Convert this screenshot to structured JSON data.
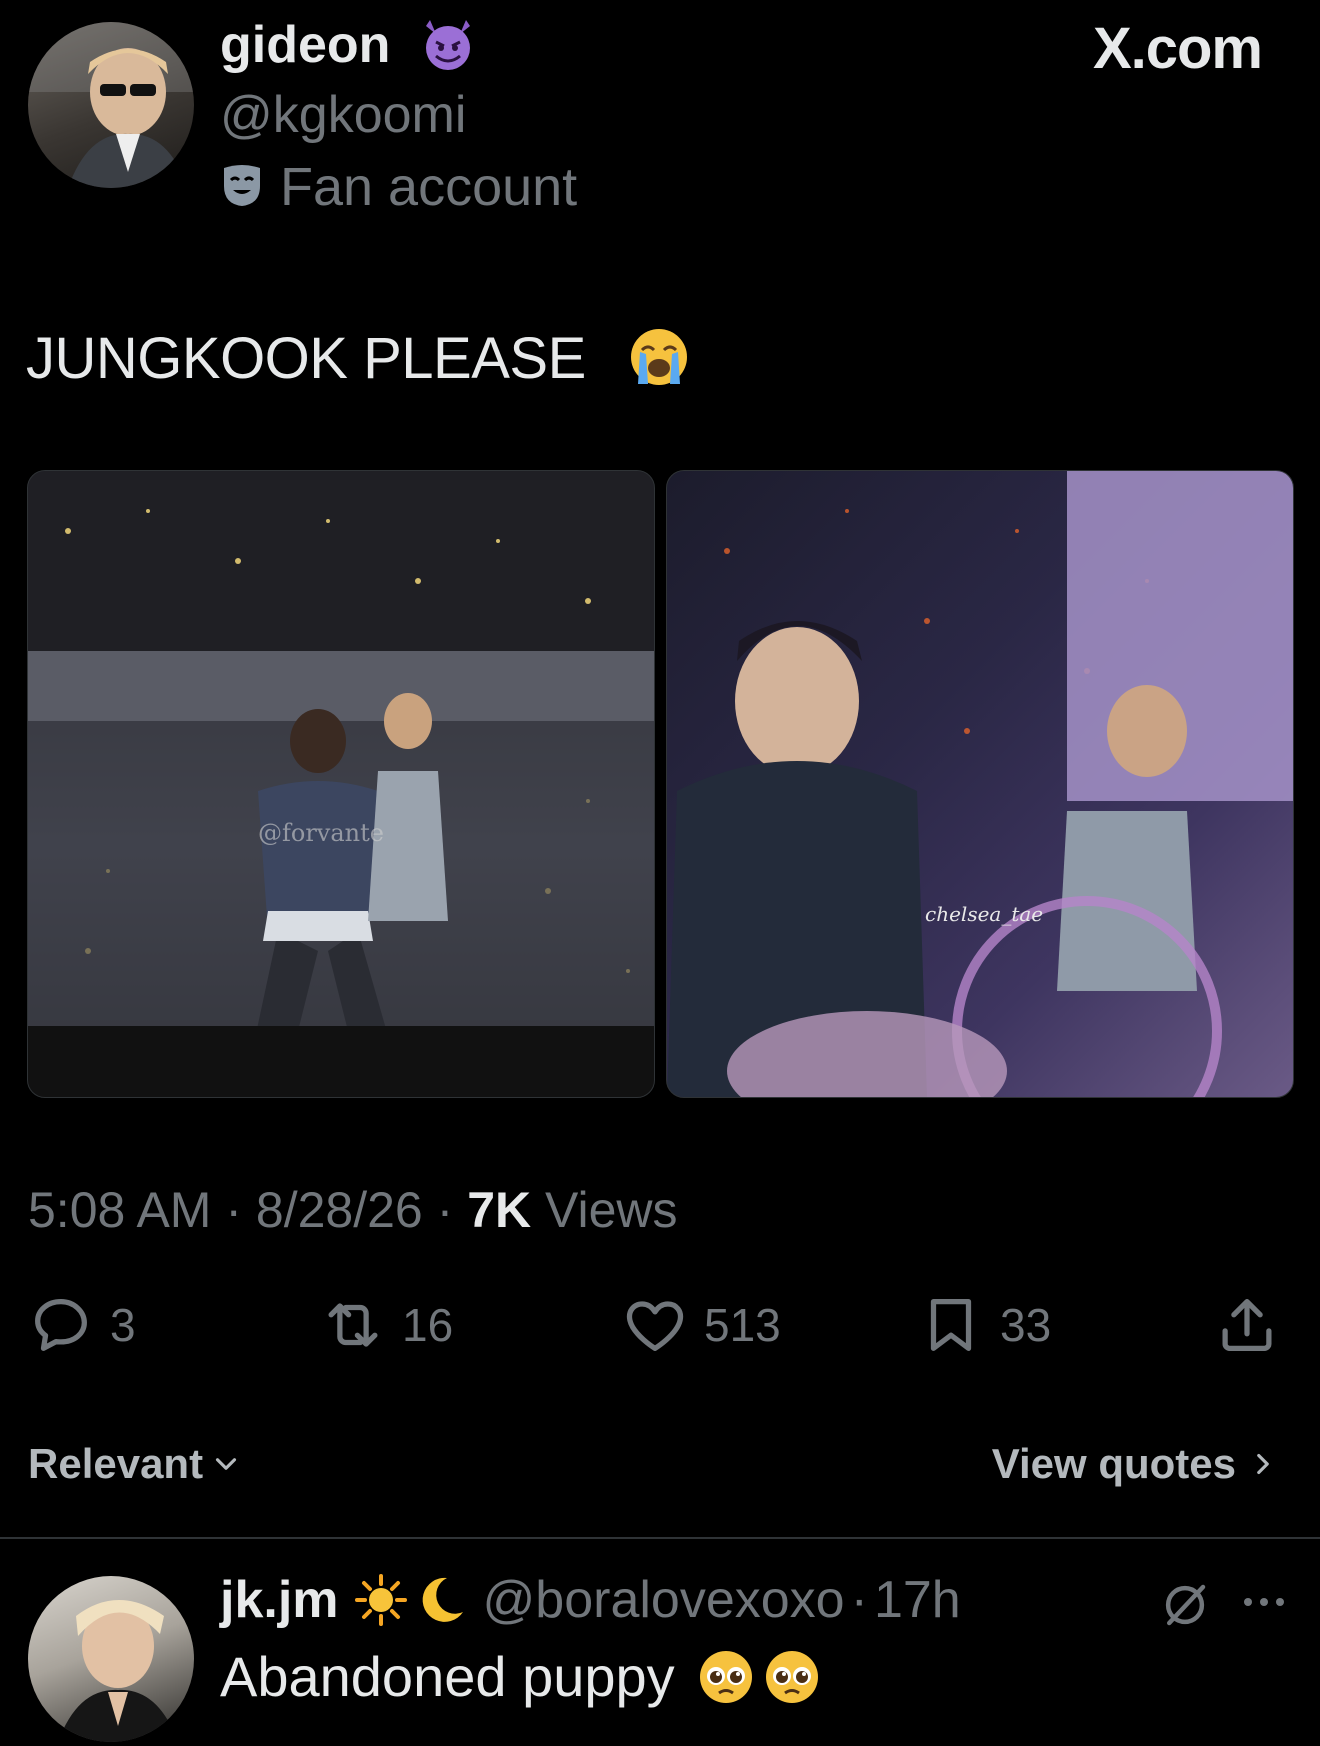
{
  "source_label": "X.com",
  "tweet": {
    "display_name": "gideon",
    "name_emoji": "smiling-imp-emoji",
    "handle": "@kgkoomi",
    "badge_label": "Fan account",
    "text": "JUNGKOOK PLEASE",
    "text_emoji": "loudly-crying-emoji",
    "media": [
      {
        "watermark": "@forvante"
      },
      {
        "watermark": "chelsea_tae"
      }
    ],
    "time": "5:08 AM",
    "date": "8/28/26",
    "views_count": "7K",
    "views_label": "Views",
    "separator": "·"
  },
  "actions": {
    "replies": "3",
    "reposts": "16",
    "likes": "513",
    "bookmarks": "33"
  },
  "sort": {
    "label": "Relevant",
    "quotes_label": "View quotes"
  },
  "reply": {
    "display_name": "jk.jm",
    "name_emojis": [
      "sun-emoji",
      "crescent-moon-emoji"
    ],
    "handle": "@boralovexoxo",
    "separator": "·",
    "time": "17h",
    "text": "Abandoned puppy",
    "text_emojis": [
      "pleading-face-emoji",
      "pleading-face-emoji"
    ]
  },
  "colors": {
    "background": "#000000",
    "primary_text": "#e7e9ea",
    "secondary_text": "#71767b",
    "divider": "#2f3336"
  }
}
